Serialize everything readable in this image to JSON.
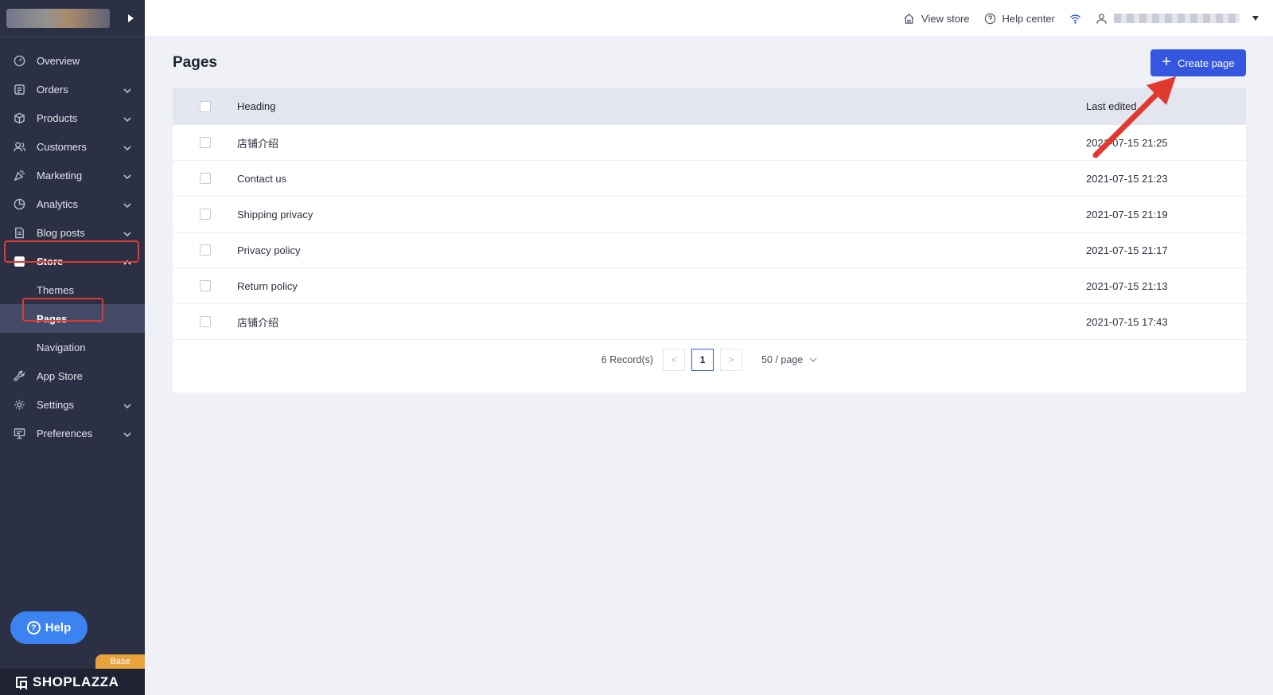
{
  "topbar": {
    "view_store": "View store",
    "help_center": "Help center"
  },
  "sidebar": {
    "items": [
      {
        "label": "Overview",
        "icon": "gauge-icon"
      },
      {
        "label": "Orders",
        "icon": "orders-icon"
      },
      {
        "label": "Products",
        "icon": "box-icon"
      },
      {
        "label": "Customers",
        "icon": "users-icon"
      },
      {
        "label": "Marketing",
        "icon": "megaphone-icon"
      },
      {
        "label": "Analytics",
        "icon": "pie-chart-icon"
      },
      {
        "label": "Blog posts",
        "icon": "document-icon"
      },
      {
        "label": "Store",
        "icon": "store-icon"
      }
    ],
    "store_sub": [
      "Themes",
      "Pages",
      "Navigation"
    ],
    "items_after": [
      {
        "label": "App Store",
        "icon": "wrench-icon"
      },
      {
        "label": "Settings",
        "icon": "gear-icon"
      },
      {
        "label": "Preferences",
        "icon": "monitor-icon"
      }
    ],
    "help_label": "Help",
    "plan_badge": "Base",
    "footer_brand": "SHOPLAZZA"
  },
  "main": {
    "title": "Pages",
    "create_button": "Create page",
    "table": {
      "columns": [
        "Heading",
        "Last edited"
      ],
      "rows": [
        {
          "heading": "店铺介绍",
          "last_edited": "2021-07-15 21:25"
        },
        {
          "heading": "Contact us",
          "last_edited": "2021-07-15 21:23"
        },
        {
          "heading": "Shipping privacy",
          "last_edited": "2021-07-15 21:19"
        },
        {
          "heading": "Privacy policy",
          "last_edited": "2021-07-15 21:17"
        },
        {
          "heading": "Return policy",
          "last_edited": "2021-07-15 21:13"
        },
        {
          "heading": "店铺介绍",
          "last_edited": "2021-07-15 17:43"
        }
      ]
    },
    "pagination": {
      "records": "6 Record(s)",
      "current_page": "1",
      "prev": "<",
      "next": ">",
      "page_size": "50 / page"
    }
  },
  "colors": {
    "sidebar_bg": "#2c3044",
    "primary": "#3557e0",
    "annotation": "#e03a30",
    "help_button": "#3b83f0",
    "plan_badge": "#e8a33d"
  }
}
